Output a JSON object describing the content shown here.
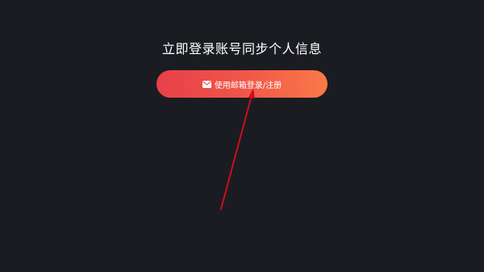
{
  "prompt": {
    "text": "立即登录账号同步个人信息"
  },
  "login_button": {
    "label": "使用邮箱登录/注册",
    "icon": "mail-icon"
  },
  "colors": {
    "background": "#1b1c21",
    "button_gradient_start": "#e8404a",
    "button_gradient_end": "#fa7a48",
    "annotation_arrow": "#c8101e"
  }
}
